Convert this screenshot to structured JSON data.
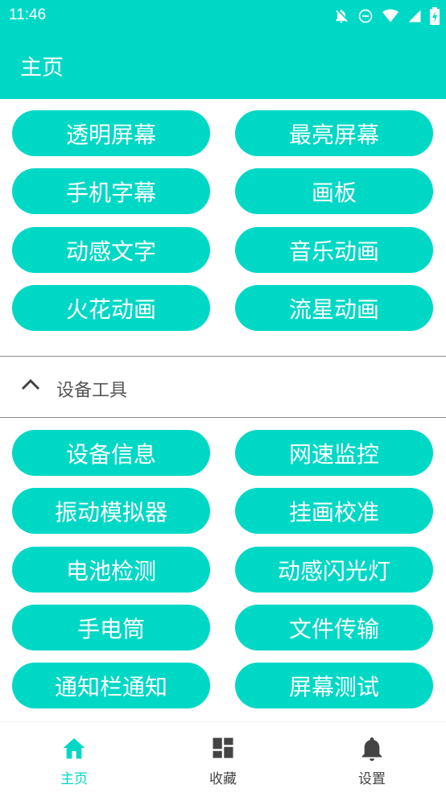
{
  "status_bar": {
    "time": "11:46",
    "icons": [
      "notifications-off-icon",
      "do-not-disturb-icon",
      "wifi-icon",
      "signal-icon",
      "battery-charging-icon"
    ]
  },
  "app_bar": {
    "title": "主页"
  },
  "colors": {
    "accent": "#00d8c6",
    "text_on_accent": "#ffffff",
    "nav_inactive": "#444444"
  },
  "top_buttons": [
    "透明屏幕",
    "最亮屏幕",
    "手机字幕",
    "画板",
    "动感文字",
    "音乐动画",
    "火花动画",
    "流星动画"
  ],
  "device_section": {
    "label": "设备工具",
    "expanded": true,
    "buttons": [
      "设备信息",
      "网速监控",
      "振动模拟器",
      "挂画校准",
      "电池检测",
      "动感闪光灯",
      "手电筒",
      "文件传输",
      "通知栏通知",
      "屏幕测试"
    ]
  },
  "bottom_nav": {
    "items": [
      {
        "label": "主页",
        "icon": "home-icon",
        "active": true
      },
      {
        "label": "收藏",
        "icon": "dashboard-icon",
        "active": false
      },
      {
        "label": "设置",
        "icon": "bell-icon",
        "active": false
      }
    ]
  }
}
